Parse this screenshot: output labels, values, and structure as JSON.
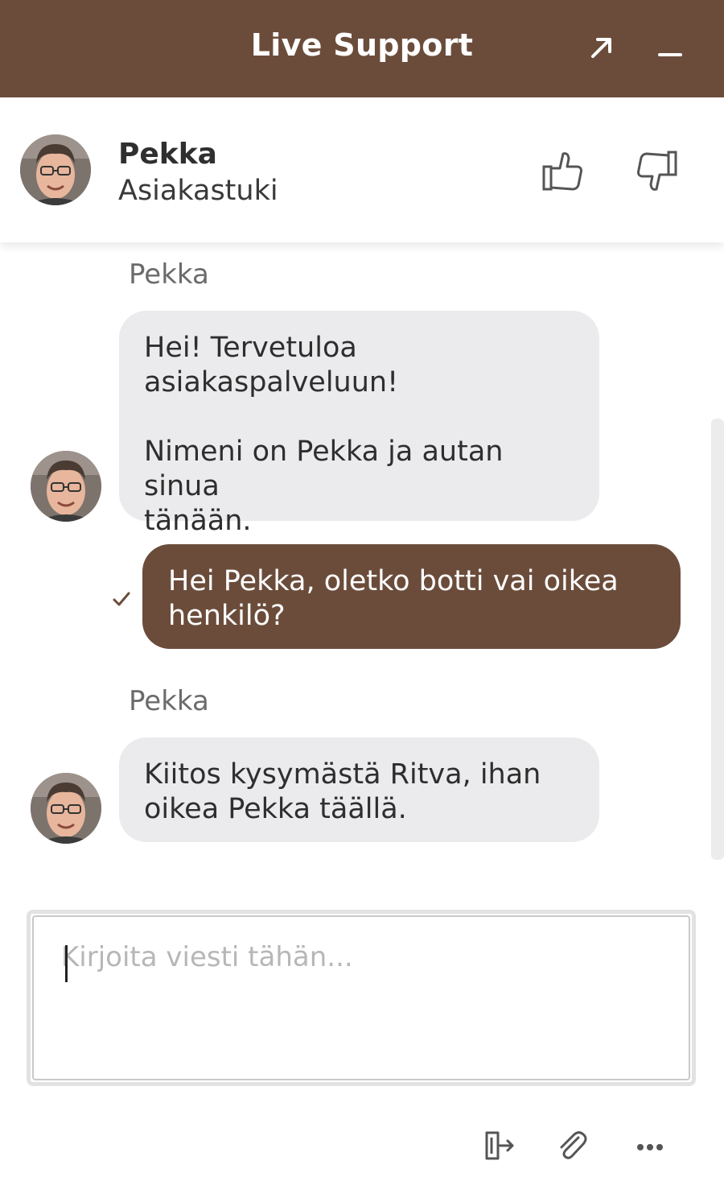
{
  "header": {
    "title": "Live Support",
    "popout_icon": "arrow-up-right-icon",
    "minimize_icon": "minus-icon",
    "background_color": "#6b4c3b"
  },
  "agent": {
    "name": "Pekka",
    "role": "Asiakastuki",
    "avatar_icon": "agent-avatar",
    "rate_up_icon": "thumbs-up-icon",
    "rate_down_icon": "thumbs-down-icon"
  },
  "messages": [
    {
      "from": "agent",
      "sender": "Pekka",
      "text": "Hei! Tervetuloa\nasiakaspalveluun!\n\nNimeni on Pekka ja autan sinua\ntänään."
    },
    {
      "from": "user",
      "text": "Hei Pekka, oletko botti vai oikea\nhenkilö?",
      "status_icon": "checkmark-icon"
    },
    {
      "from": "agent",
      "sender": "Pekka",
      "text": "Kiitos kysymästä Ritva, ihan\noikea Pekka täällä."
    }
  ],
  "composer": {
    "placeholder": "Kirjoita viesti tähän...",
    "value": ""
  },
  "toolbar": {
    "end_chat_icon": "exit-door-icon",
    "attach_icon": "paperclip-icon",
    "more_icon": "more-dots-icon"
  },
  "colors": {
    "brand": "#6b4c3b",
    "agent_bubble": "#ebebed",
    "user_bubble": "#6b4c3b"
  }
}
